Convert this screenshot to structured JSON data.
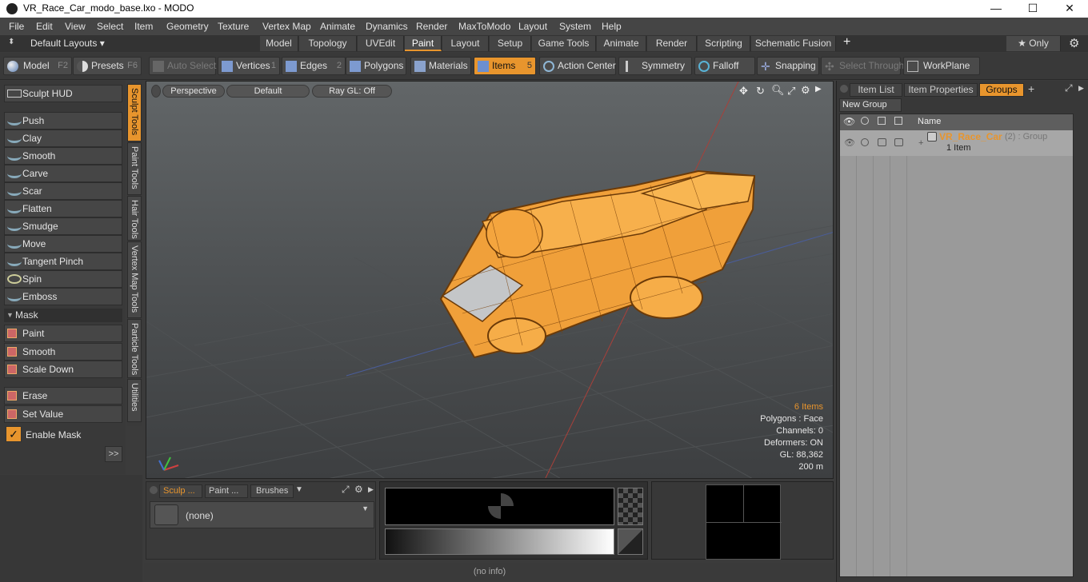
{
  "window": {
    "title": "VR_Race_Car_modo_base.lxo - MODO",
    "minimize": "—",
    "maximize": "☐",
    "close": "✕"
  },
  "menu": [
    "File",
    "Edit",
    "View",
    "Select",
    "Item",
    "Geometry",
    "Texture",
    "Vertex Map",
    "Animate",
    "Dynamics",
    "Render",
    "MaxToModo",
    "Layout",
    "System",
    "Help"
  ],
  "layout_bar": {
    "layouts_label": "Default Layouts ▾",
    "tabs": [
      "Model",
      "Topology",
      "UVEdit",
      "Paint",
      "Layout",
      "Setup",
      "Game Tools",
      "Animate",
      "Render",
      "Scripting",
      "Schematic Fusion"
    ],
    "active_tab": "Paint",
    "add": "+",
    "only": "★  Only",
    "settings": "⚙"
  },
  "toolbar": {
    "model": "Model",
    "model_key": "F2",
    "presets": "Presets",
    "presets_key": "F6",
    "auto_select": "Auto Select",
    "vertices": "Vertices",
    "vertices_key": "1",
    "edges": "Edges",
    "edges_key": "2",
    "polygons": "Polygons",
    "materials": "Materials",
    "items": "Items",
    "items_key": "5",
    "action_center": "Action Center",
    "symmetry": "Symmetry",
    "falloff": "Falloff",
    "snapping": "Snapping",
    "select_through": "Select Through",
    "workplane": "WorkPlane"
  },
  "left_panel": {
    "sculpt_hud": "Sculpt HUD",
    "tools": [
      "Push",
      "Clay",
      "Smooth",
      "Carve",
      "Scar",
      "Flatten",
      "Smudge",
      "Move",
      "Tangent Pinch",
      "Spin",
      "Emboss"
    ],
    "mask_header": "Mask",
    "mask_tools": [
      "Paint",
      "Smooth",
      "Scale Down"
    ],
    "value_tools": [
      "Erase",
      "Set Value"
    ],
    "enable_mask": "Enable Mask",
    "more": ">>",
    "vtabs": [
      "Sculpt Tools",
      "Paint Tools",
      "Hair Tools",
      "Vertex Map Tools",
      "Particle Tools",
      "Utilities"
    ]
  },
  "viewport": {
    "view": "Perspective",
    "style": "Default",
    "render": "Ray GL: Off",
    "stats": {
      "items": "6 Items",
      "polygons": "Polygons : Face",
      "channels": "Channels: 0",
      "deformers": "Deformers: ON",
      "gl": "GL: 88,362",
      "distance": "200 m"
    }
  },
  "bottom": {
    "tabs": [
      "Sculp ...",
      "Paint ...",
      "Brushes"
    ],
    "preset_value": "(none)",
    "status": "(no info)"
  },
  "right_panel": {
    "tabs": [
      "Item List",
      "Item Properties",
      "Groups"
    ],
    "active_tab": "Groups",
    "new_group": "New Group",
    "column_name": "Name",
    "group_name": "VR_Race_Car",
    "group_meta": "(2) : Group",
    "group_sub": "1 Item"
  },
  "colors": {
    "accent": "#e8952d",
    "wire": "#ff9a1f"
  }
}
